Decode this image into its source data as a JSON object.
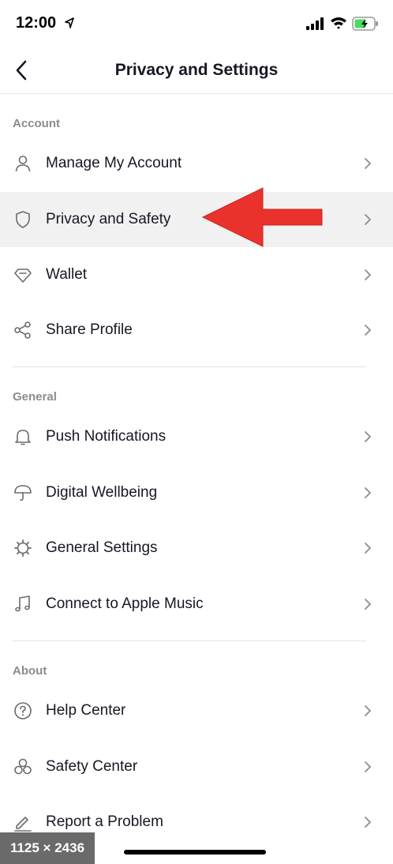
{
  "status_bar": {
    "time": "12:00"
  },
  "header": {
    "title": "Privacy and Settings"
  },
  "sections": {
    "account": {
      "label": "Account",
      "items": [
        {
          "label": "Manage My Account",
          "icon": "person-icon"
        },
        {
          "label": "Privacy and Safety",
          "icon": "shield-icon",
          "highlighted": true
        },
        {
          "label": "Wallet",
          "icon": "diamond-icon"
        },
        {
          "label": "Share Profile",
          "icon": "share-icon"
        }
      ]
    },
    "general": {
      "label": "General",
      "items": [
        {
          "label": "Push Notifications",
          "icon": "bell-icon"
        },
        {
          "label": "Digital Wellbeing",
          "icon": "umbrella-icon"
        },
        {
          "label": "General Settings",
          "icon": "gear-icon"
        },
        {
          "label": "Connect to Apple Music",
          "icon": "music-note-icon"
        }
      ]
    },
    "about": {
      "label": "About",
      "items": [
        {
          "label": "Help Center",
          "icon": "question-circle-icon"
        },
        {
          "label": "Safety Center",
          "icon": "safety-center-icon"
        },
        {
          "label": "Report a Problem",
          "icon": "pencil-icon"
        }
      ]
    }
  },
  "overlay": {
    "dimensions": "1125 × 2436"
  },
  "colors": {
    "annotation_arrow": "#e8322b",
    "highlight_row": "#f1f1f2",
    "battery_charge": "#4cd964"
  }
}
